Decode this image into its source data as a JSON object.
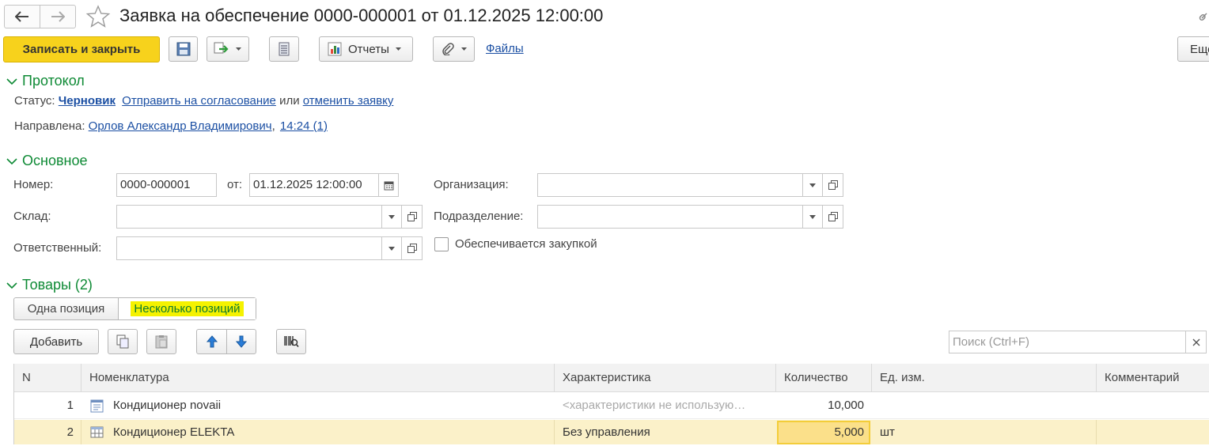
{
  "window": {
    "title": "Заявка на обеспечение 0000-000001 от 01.12.2025 12:00:00"
  },
  "toolbar": {
    "save_close_label": "Записать и закрыть",
    "reports_label": "Отчеты",
    "files_label": "Файлы",
    "more_label": "Еще"
  },
  "protocol": {
    "title": "Протокол",
    "status_label": "Статус:",
    "status_value": "Черновик",
    "send_link": "Отправить на согласование",
    "or_text": "или",
    "cancel_link": "отменить заявку",
    "sent_label": "Направлена:",
    "sent_person": "Орлов Александр Владимирович",
    "sent_comma": ",",
    "sent_time": "14:24 (1)"
  },
  "main": {
    "title": "Основное",
    "number_label": "Номер:",
    "number_value": "0000-000001",
    "from_label": "от:",
    "date_value": "01.12.2025 12:00:00",
    "org_label": "Организация:",
    "org_value": "",
    "warehouse_label": "Склад:",
    "warehouse_value": "",
    "department_label": "Подразделение:",
    "department_value": "",
    "responsible_label": "Ответственный:",
    "responsible_value": "",
    "purchase_checkbox_label": "Обеспечивается закупкой",
    "purchase_checked": false
  },
  "goods": {
    "title": "Товары (2)",
    "mode_single": "Одна позиция",
    "mode_multi": "Несколько позиций",
    "add_label": "Добавить",
    "search_placeholder": "Поиск (Ctrl+F)",
    "columns": [
      "N",
      "Номенклатура",
      "Характеристика",
      "Количество",
      "Ед. изм.",
      "Комментарий"
    ],
    "rows": [
      {
        "n": "1",
        "name": "Кондиционер novaii",
        "characteristic": "<характеристики не использую…",
        "quantity": "10,000",
        "unit": "",
        "comment": "",
        "icon": "document-icon"
      },
      {
        "n": "2",
        "name": "Кондиционер ELEKTA",
        "characteristic": "Без управления",
        "quantity": "5,000",
        "unit": "шт",
        "comment": "",
        "icon": "table-icon"
      }
    ]
  },
  "colors": {
    "accent_yellow": "#f7d21c",
    "section_green": "#0e8a35",
    "link_blue": "#1b4fa3",
    "selected_row": "#fbf1c9",
    "highlight": "#f5f200"
  }
}
